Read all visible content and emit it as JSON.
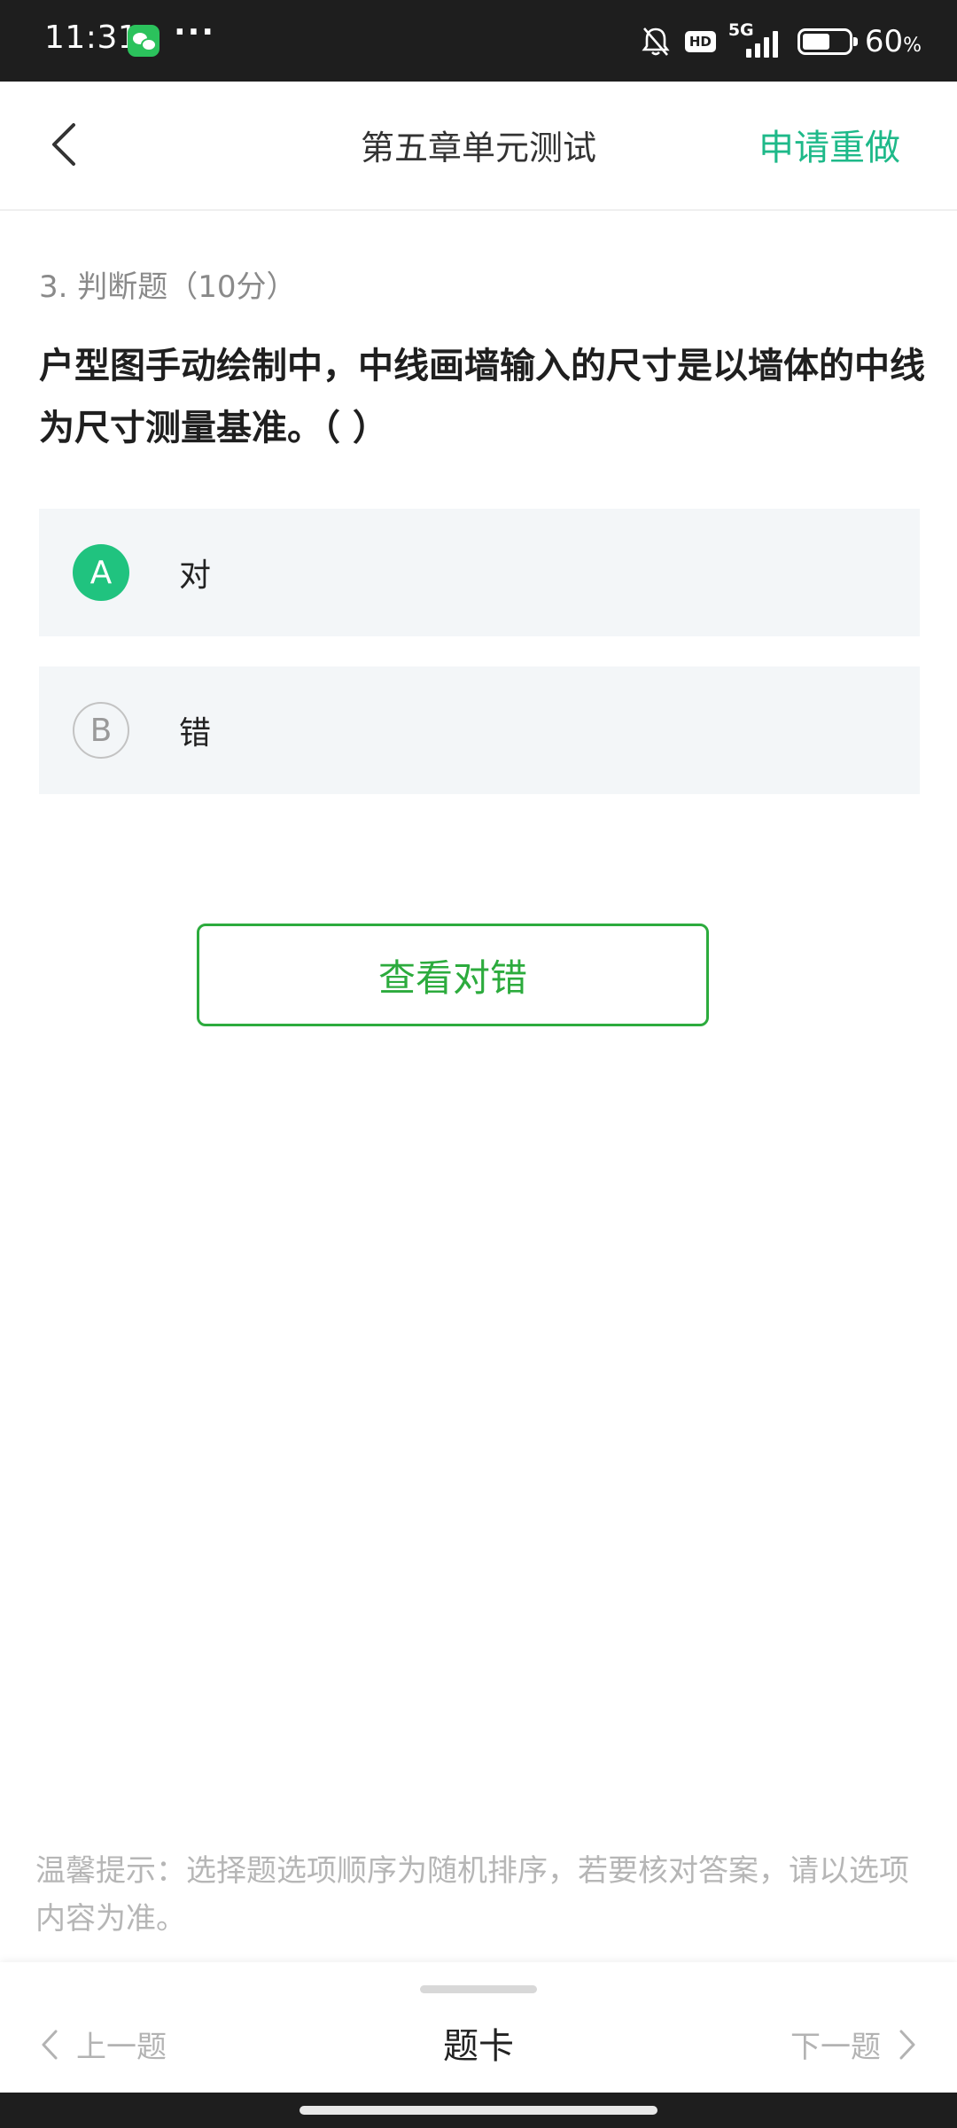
{
  "status_bar": {
    "time": "11:31",
    "dots": "···",
    "hd_label": "HD",
    "network_label": "5G",
    "battery_percent": "60",
    "percent_sign": "%",
    "battery_level": 0.6,
    "icons": [
      "wechat-icon",
      "bell-muted-icon",
      "signal-icon",
      "battery-icon"
    ]
  },
  "header": {
    "title": "第五章单元测试",
    "redo_label": "申请重做",
    "accent_color": "#1eb989"
  },
  "question": {
    "meta": "3. 判断题（10分）",
    "text": "户型图手动绘制中，中线画墙输入的尺寸是以墙体的中线为尺寸测量基准。（ ）",
    "options": [
      {
        "letter": "A",
        "text": "对",
        "selected": true
      },
      {
        "letter": "B",
        "text": "错",
        "selected": false
      }
    ]
  },
  "actions": {
    "check_label": "查看对错",
    "check_color": "#2cab3d"
  },
  "tip": "温馨提示：选择题选项顺序为随机排序，若要核对答案，请以选项内容为准。",
  "bottom_nav": {
    "prev_label": "上一题",
    "card_label": "题卡",
    "next_label": "下一题"
  }
}
